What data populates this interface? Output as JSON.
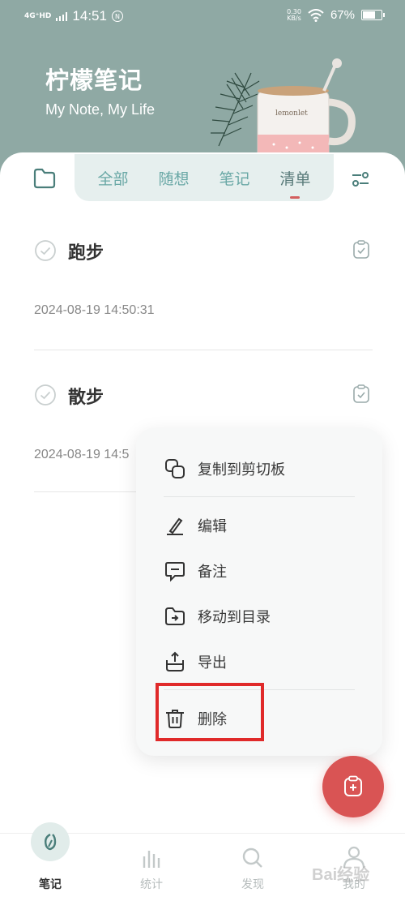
{
  "status_bar": {
    "network": "4G⁺HD",
    "time": "14:51",
    "nfc": "N",
    "speed_value": "0.30",
    "speed_unit": "KB/s",
    "battery": "67%",
    "battery_level": 0.67
  },
  "header": {
    "title": "柠檬笔记",
    "subtitle": "My Note, My Life",
    "mug_text": "lemonlet"
  },
  "tabs": [
    {
      "label": "全部",
      "active": false
    },
    {
      "label": "随想",
      "active": false
    },
    {
      "label": "笔记",
      "active": false
    },
    {
      "label": "清单",
      "active": true
    }
  ],
  "notes": [
    {
      "title": "跑步",
      "date": "2024-08-19 14:50:31"
    },
    {
      "title": "散步",
      "date": "2024-08-19 14:5"
    }
  ],
  "context_menu": {
    "items": [
      {
        "label": "复制到剪切板",
        "icon": "copy-icon"
      },
      {
        "label": "编辑",
        "icon": "edit-icon"
      },
      {
        "label": "备注",
        "icon": "comment-icon"
      },
      {
        "label": "移动到目录",
        "icon": "folder-move-icon"
      },
      {
        "label": "导出",
        "icon": "export-icon"
      },
      {
        "label": "删除",
        "icon": "trash-icon"
      }
    ]
  },
  "bottom_nav": [
    {
      "label": "笔记",
      "icon": "note-leaf-icon",
      "active": true
    },
    {
      "label": "统计",
      "icon": "bar-stats-icon",
      "active": false
    },
    {
      "label": "发现",
      "icon": "search-icon",
      "active": false
    },
    {
      "label": "我的",
      "icon": "profile-icon",
      "active": false
    }
  ],
  "watermark": "Bai经验",
  "colors": {
    "header_bg": "#8fa9a4",
    "accent_teal": "#6aa8a6",
    "fab_red": "#d95454",
    "highlight_red": "#e02a2a"
  }
}
